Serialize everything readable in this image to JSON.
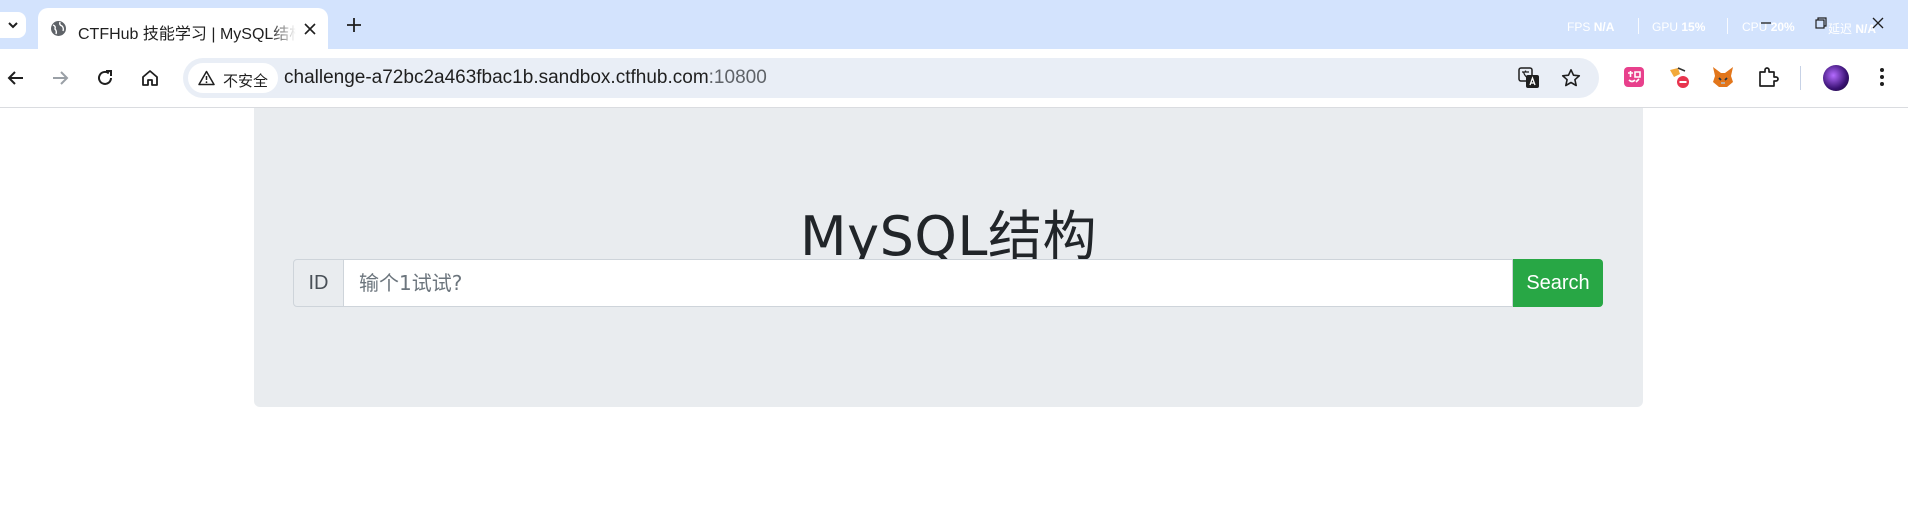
{
  "browser": {
    "tab": {
      "title": "CTFHub 技能学习 | MySQL结构",
      "favicon": "globe-icon"
    },
    "perf": {
      "fps_label": "FPS",
      "fps_value": "N/A",
      "gpu_label": "GPU",
      "gpu_value": "15%",
      "cpu_label": "CPU",
      "cpu_value": "20%",
      "net_label": "延迟",
      "net_value": "N/A"
    },
    "omnibox": {
      "security_label": "不安全",
      "url_host": "challenge-a72bc2a463fbac1b.sandbox.ctfhub.com",
      "url_port": ":10800"
    },
    "colors": {
      "tabstrip": "#d3e3fd",
      "omnibox": "#e9eef6"
    }
  },
  "page": {
    "title": "MySQL结构",
    "search": {
      "prefix_label": "ID",
      "placeholder": "输个1试试?",
      "value": "",
      "button_label": "Search"
    },
    "colors": {
      "jumbotron": "#e9ecef",
      "button": "#28a745",
      "title_text": "#212529"
    }
  }
}
